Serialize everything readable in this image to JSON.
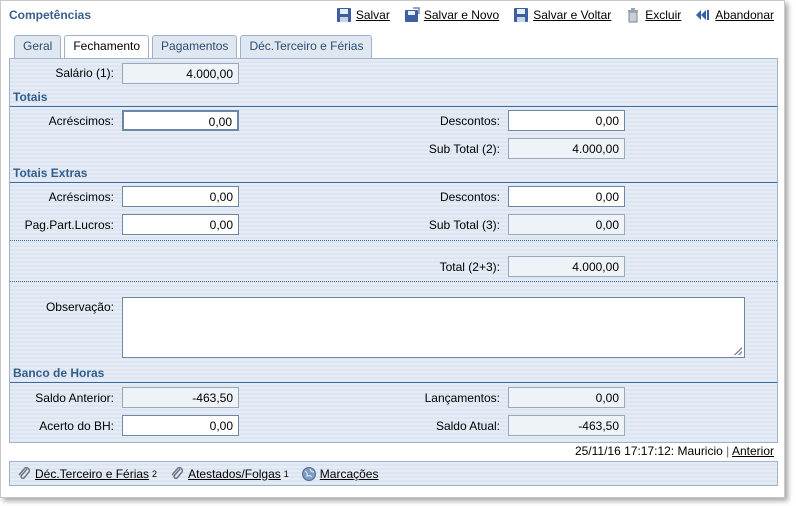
{
  "header": {
    "title": "Competências",
    "actions": {
      "save": "Salvar",
      "save_new": "Salvar e Novo",
      "save_back": "Salvar e Voltar",
      "delete": "Excluir",
      "abandon": "Abandonar"
    }
  },
  "tabs": [
    "Geral",
    "Fechamento",
    "Pagamentos",
    "Déc.Terceiro e Férias"
  ],
  "active_tab": "Fechamento",
  "form": {
    "salario_label": "Salário (1):",
    "salario_value": "4.000,00",
    "totais_title": "Totais",
    "acrescimos_label": "Acréscimos:",
    "acrescimos_value": "0,00",
    "descontos_label": "Descontos:",
    "descontos_value": "0,00",
    "subtotal2_label": "Sub Total (2):",
    "subtotal2_value": "4.000,00",
    "extras_title": "Totais Extras",
    "extra_acrescimos_label": "Acréscimos:",
    "extra_acrescimos_value": "0,00",
    "extra_descontos_label": "Descontos:",
    "extra_descontos_value": "0,00",
    "ppl_label": "Pag.Part.Lucros:",
    "ppl_value": "0,00",
    "subtotal3_label": "Sub Total (3):",
    "subtotal3_value": "0,00",
    "total_label": "Total (2+3):",
    "total_value": "4.000,00",
    "observacao_label": "Observação:",
    "observacao_value": "",
    "banco_title": "Banco de Horas",
    "saldo_anterior_label": "Saldo Anterior:",
    "saldo_anterior_value": "-463,50",
    "lancamentos_label": "Lançamentos:",
    "lancamentos_value": "0,00",
    "acerto_label": "Acerto do BH:",
    "acerto_value": "0,00",
    "saldo_atual_label": "Saldo Atual:",
    "saldo_atual_value": "-463,50"
  },
  "stamp": {
    "text": "25/11/16 17:17:12: Mauricio",
    "separator": "|",
    "link": "Anterior"
  },
  "bottom_links": [
    {
      "label": "Déc.Terceiro e Férias",
      "count": "2",
      "icon": "paperclip-icon"
    },
    {
      "label": "Atestados/Folgas",
      "count": "1",
      "icon": "paperclip-icon"
    },
    {
      "label": "Marcações",
      "count": "",
      "icon": "globe-icon"
    }
  ]
}
